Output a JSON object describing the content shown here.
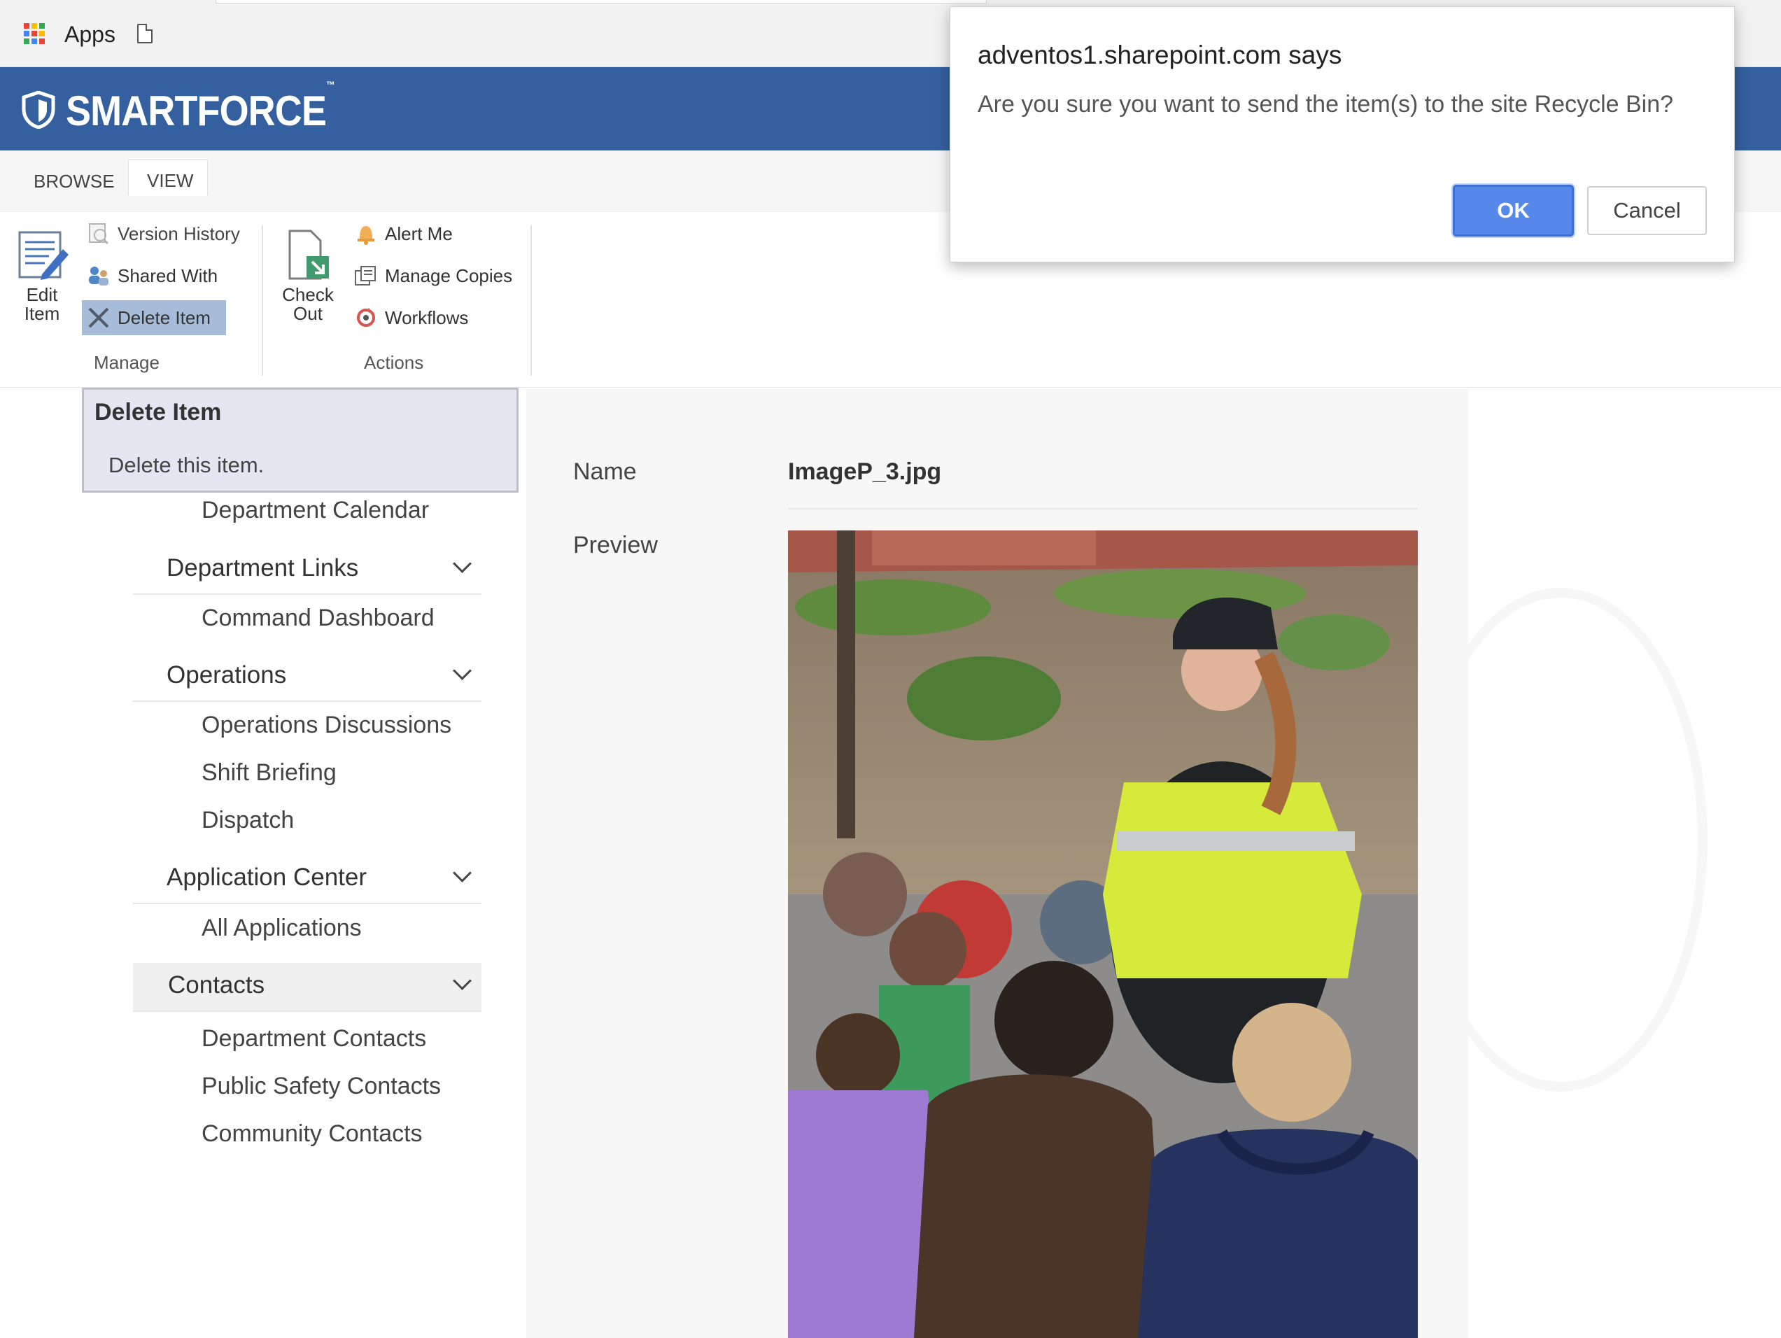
{
  "browser": {
    "bookmarks": {
      "apps_label": "Apps"
    }
  },
  "header": {
    "logo_text": "SMARTFORCE",
    "logo_tm": "™",
    "brand_color": "#34609f"
  },
  "ribbon": {
    "tabs": [
      {
        "label": "BROWSE"
      },
      {
        "label": "VIEW"
      }
    ],
    "manage": {
      "group_label": "Manage",
      "edit_item_line1": "Edit",
      "edit_item_line2": "Item",
      "version_history": "Version History",
      "shared_with": "Shared With",
      "delete_item": "Delete Item"
    },
    "actions": {
      "group_label": "Actions",
      "check_out_line1": "Check",
      "check_out_line2": "Out",
      "alert_me": "Alert Me",
      "manage_copies": "Manage Copies",
      "workflows": "Workflows"
    }
  },
  "tooltip": {
    "title": "Delete Item",
    "description": "Delete this item."
  },
  "left_nav": {
    "top_link": "Department Calendar",
    "sections": [
      {
        "heading": "Department Links",
        "links": [
          "Command Dashboard"
        ]
      },
      {
        "heading": "Operations",
        "links": [
          "Operations Discussions",
          "Shift Briefing",
          "Dispatch"
        ]
      },
      {
        "heading": "Application Center",
        "links": [
          "All Applications"
        ]
      },
      {
        "heading": "Contacts",
        "links": [
          "Department Contacts",
          "Public Safety Contacts",
          "Community Contacts"
        ]
      }
    ]
  },
  "item": {
    "name_label": "Name",
    "name_value": "ImageP_3.jpg",
    "preview_label": "Preview"
  },
  "dialog": {
    "title": "adventos1.sharepoint.com says",
    "message": "Are you sure you want to send the item(s) to the site Recycle Bin?",
    "ok_label": "OK",
    "cancel_label": "Cancel",
    "ok_color": "#5588e8"
  }
}
